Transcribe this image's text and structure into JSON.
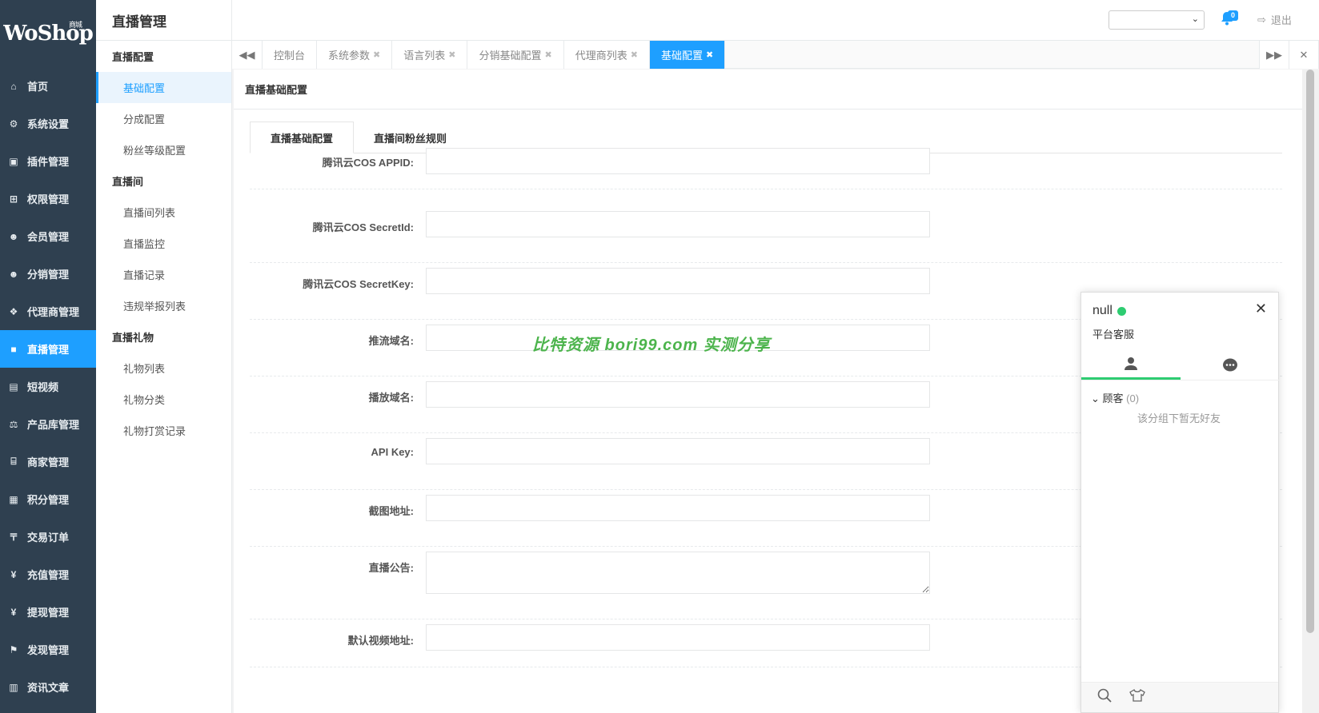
{
  "app": {
    "logo_text": "WoShop",
    "logo_sup": "商城",
    "section_title": "直播管理"
  },
  "leftnav": [
    {
      "icon": "home-icon",
      "glyph": "⌂",
      "label": "首页"
    },
    {
      "icon": "gear-icon",
      "glyph": "⚙",
      "label": "系统设置"
    },
    {
      "icon": "plugin-icon",
      "glyph": "▣",
      "label": "插件管理"
    },
    {
      "icon": "sitemap-icon",
      "glyph": "⊞",
      "label": "权限管理"
    },
    {
      "icon": "users-icon",
      "glyph": "☻",
      "label": "会员管理"
    },
    {
      "icon": "users-icon",
      "glyph": "☻",
      "label": "分销管理"
    },
    {
      "icon": "cubes-icon",
      "glyph": "❖",
      "label": "代理商管理"
    },
    {
      "icon": "video-camera-icon",
      "glyph": "■",
      "label": "直播管理"
    },
    {
      "icon": "file-video-icon",
      "glyph": "▤",
      "label": "短视频"
    },
    {
      "icon": "balance-scale-icon",
      "glyph": "⚖",
      "label": "产品库管理"
    },
    {
      "icon": "bank-icon",
      "glyph": "⌸",
      "label": "商家管理"
    },
    {
      "icon": "file-icon",
      "glyph": "▦",
      "label": "积分管理"
    },
    {
      "icon": "rmb-icon",
      "glyph": "〒",
      "label": "交易订单"
    },
    {
      "icon": "yen-icon",
      "glyph": "¥",
      "label": "充值管理"
    },
    {
      "icon": "yen-icon",
      "glyph": "¥",
      "label": "提现管理"
    },
    {
      "icon": "flag-icon",
      "glyph": "⚑",
      "label": "发现管理"
    },
    {
      "icon": "newspaper-icon",
      "glyph": "▥",
      "label": "资讯文章"
    }
  ],
  "subnav": [
    {
      "type": "group",
      "label": "直播配置"
    },
    {
      "type": "item",
      "label": "基础配置",
      "active": true
    },
    {
      "type": "item",
      "label": "分成配置"
    },
    {
      "type": "item",
      "label": "粉丝等级配置"
    },
    {
      "type": "group",
      "label": "直播间"
    },
    {
      "type": "item",
      "label": "直播间列表"
    },
    {
      "type": "item",
      "label": "直播监控"
    },
    {
      "type": "item",
      "label": "直播记录"
    },
    {
      "type": "item",
      "label": "违规举报列表"
    },
    {
      "type": "group",
      "label": "直播礼物"
    },
    {
      "type": "item",
      "label": "礼物列表"
    },
    {
      "type": "item",
      "label": "礼物分类"
    },
    {
      "type": "item",
      "label": "礼物打赏记录"
    }
  ],
  "header": {
    "notification_count": "0",
    "logout_label": "退出"
  },
  "tabs": [
    {
      "label": "控制台",
      "closable": false
    },
    {
      "label": "系统参数",
      "closable": true
    },
    {
      "label": "语言列表",
      "closable": true
    },
    {
      "label": "分销基础配置",
      "closable": true
    },
    {
      "label": "代理商列表",
      "closable": true
    },
    {
      "label": "基础配置",
      "closable": true,
      "active": true
    }
  ],
  "page": {
    "title": "直播基础配置",
    "inner_tabs": [
      "直播基础配置",
      "直播间粉丝规则"
    ]
  },
  "form": [
    {
      "label": "腾讯云COS APPID:",
      "value": ""
    },
    {
      "label": "腾讯云COS SecretId:",
      "value": ""
    },
    {
      "label": "腾讯云COS SecretKey:",
      "value": ""
    },
    {
      "label": "推流域名:",
      "value": ""
    },
    {
      "label": "播放域名:",
      "value": ""
    },
    {
      "label": "API Key:",
      "value": ""
    },
    {
      "label": "截图地址:",
      "value": ""
    },
    {
      "label": "直播公告:",
      "value": "",
      "multiline": true
    },
    {
      "label": "默认视频地址:",
      "value": ""
    }
  ],
  "watermark": "比特资源 bori99.com 实测分享",
  "chat": {
    "name": "null",
    "status_color": "#2ecc71",
    "subtitle": "平台客服",
    "group_label": "顾客",
    "group_count": "(0)",
    "empty_text": "该分组下暂无好友"
  },
  "colors": {
    "accent": "#1e9fff",
    "nav_bg": "#2f4050",
    "online": "#2ecc71"
  }
}
